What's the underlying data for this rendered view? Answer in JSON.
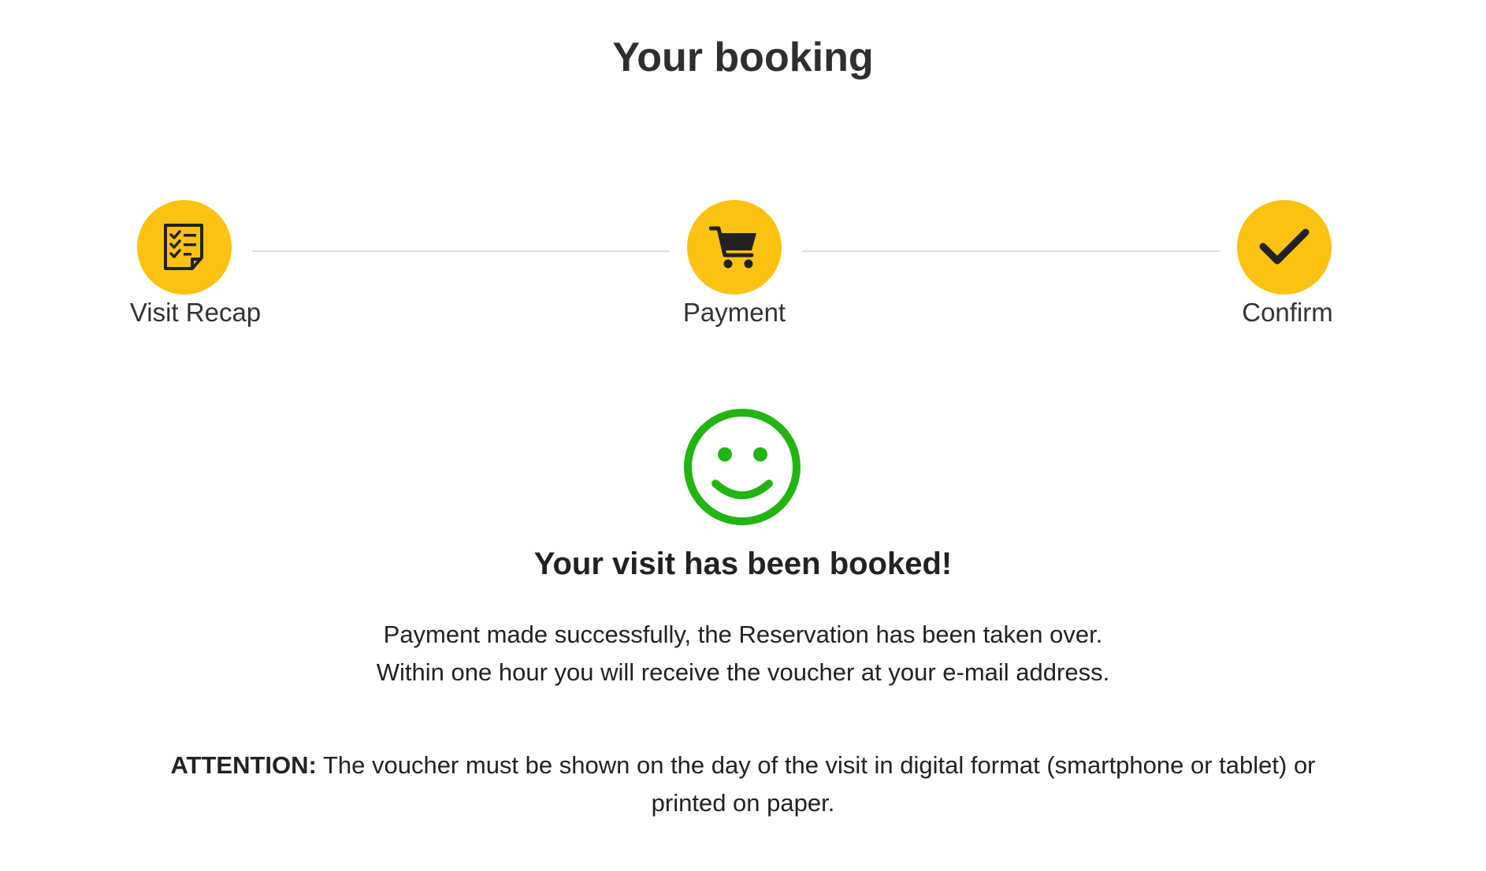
{
  "page_title": "Your booking",
  "steps": [
    {
      "label": "Visit Recap",
      "icon": "checklist-icon"
    },
    {
      "label": "Payment",
      "icon": "cart-icon"
    },
    {
      "label": "Confirm",
      "icon": "checkmark-icon"
    }
  ],
  "colors": {
    "step_circle": "#fcc212",
    "icon_dark": "#222222",
    "success_green": "#22b512",
    "connector": "#dcdcdc"
  },
  "result": {
    "icon": "smiley-icon",
    "title": "Your visit has been booked!",
    "message_line1": "Payment made successfully, the Reservation has been taken over.",
    "message_line2": "Within one hour you will receive the voucher at your e-mail address."
  },
  "attention": {
    "label": "ATTENTION:",
    "text": "The voucher must be shown on the day of the visit in digital format (smartphone or tablet) or printed on paper."
  }
}
